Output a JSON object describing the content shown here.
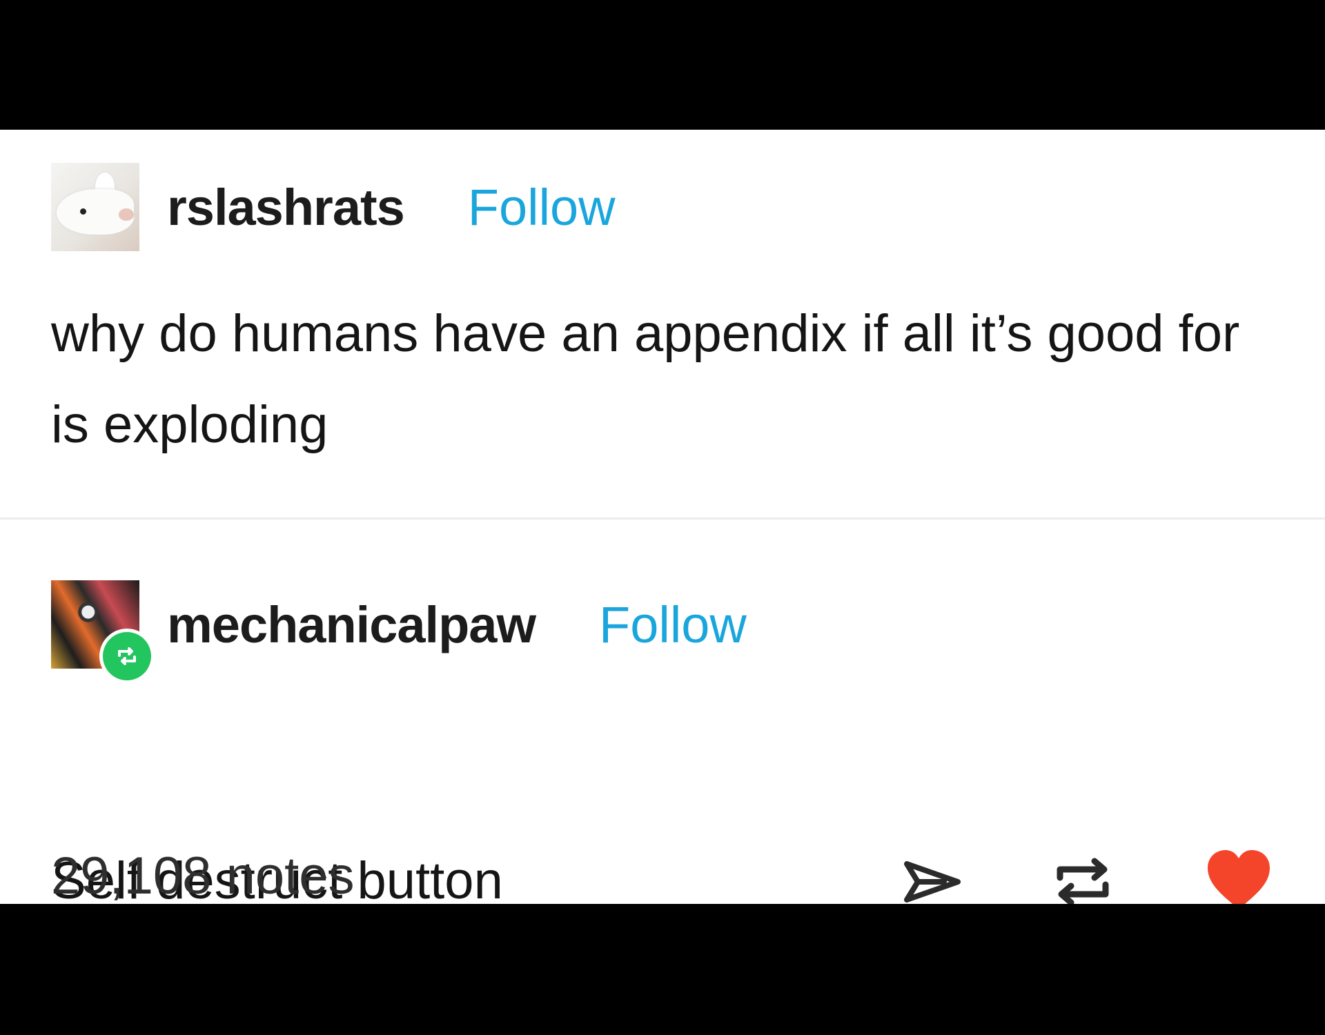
{
  "colors": {
    "background": "#000000",
    "card": "#ffffff",
    "follow_link": "#1aa6dc",
    "reblog_badge": "#22c55e",
    "like_heart": "#f4452b",
    "text": "#151515"
  },
  "posts": [
    {
      "avatar_icon": "rat-avatar",
      "username": "rslashrats",
      "follow_label": "Follow",
      "text": "why do humans have an appendix if all it’s good for is exploding"
    },
    {
      "avatar_icon": "robot-avatar",
      "badge_icon": "reblog-badge-icon",
      "username": "mechanicalpaw",
      "follow_label": "Follow",
      "text": "Self destruct button"
    }
  ],
  "footer": {
    "notes_label": "29,108 notes",
    "actions": [
      "share-icon",
      "reblog-icon",
      "heart-icon"
    ],
    "liked": true
  }
}
